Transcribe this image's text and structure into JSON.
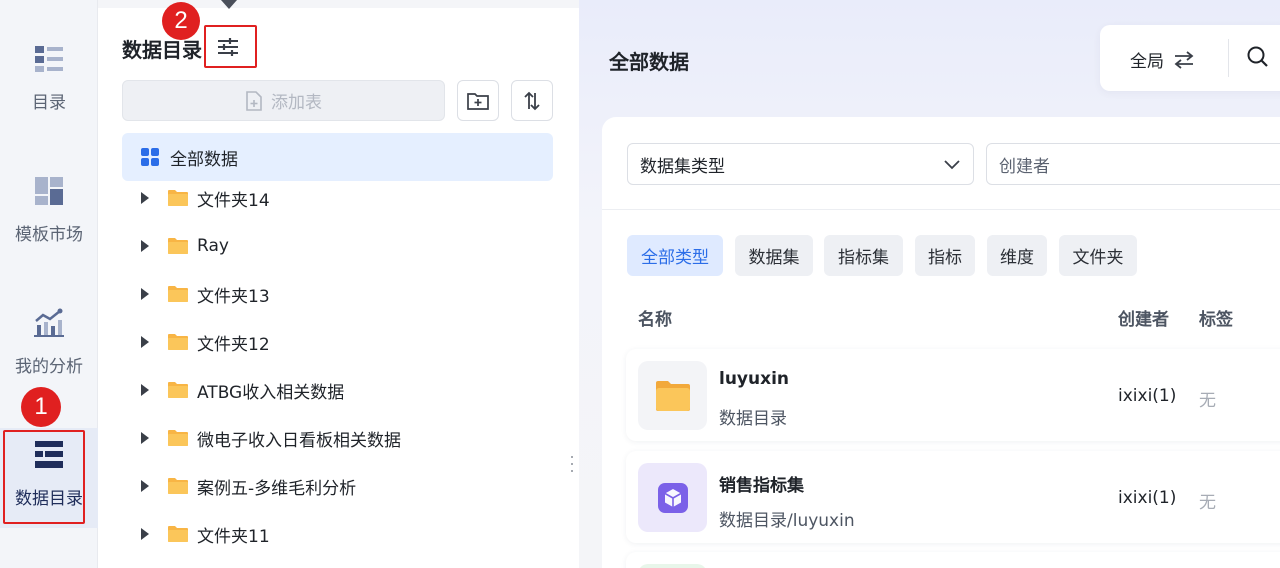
{
  "nav": {
    "items": [
      {
        "label": "目录",
        "icon": "catalog-list-icon"
      },
      {
        "label": "模板市场",
        "icon": "template-grid-icon"
      },
      {
        "label": "我的分析",
        "icon": "analysis-chart-icon"
      },
      {
        "label": "数据目录",
        "icon": "data-catalog-icon",
        "active": true
      }
    ],
    "annotation_1": "1"
  },
  "panel": {
    "title": "数据目录",
    "annotation_2": "2",
    "filter_icon": "filter-sliders-icon",
    "add_table_label": "添加表",
    "add_table_icon": "add-table-icon",
    "new_folder_icon": "folder-plus-icon",
    "sort_icon": "sort-icon",
    "tree_root_label": "全部数据",
    "tree_items": [
      {
        "label": "文件夹14"
      },
      {
        "label": "Ray"
      },
      {
        "label": "文件夹13"
      },
      {
        "label": "文件夹12"
      },
      {
        "label": "ATBG收入相关数据"
      },
      {
        "label": "微电子收入日看板相关数据"
      },
      {
        "label": "案例五-多维毛利分析"
      },
      {
        "label": "文件夹11"
      }
    ]
  },
  "main": {
    "title": "全部数据",
    "scope_label": "全局",
    "scope_icon": "swap-icon",
    "search_icon": "search-icon",
    "filters": {
      "dataset_type_placeholder": "数据集类型",
      "creator_placeholder": "创建者"
    },
    "type_chips": [
      {
        "label": "全部类型",
        "active": true
      },
      {
        "label": "数据集"
      },
      {
        "label": "指标集"
      },
      {
        "label": "指标"
      },
      {
        "label": "维度"
      },
      {
        "label": "文件夹"
      }
    ],
    "columns": {
      "name": "名称",
      "creator": "创建者",
      "tags": "标签"
    },
    "rows": [
      {
        "name": "luyuxin",
        "path": "数据目录",
        "creator": "ixixi(1)",
        "tags": "无",
        "icon": "folder-icon"
      },
      {
        "name": "销售指标集",
        "path": "数据目录/luyuxin",
        "creator": "ixixi(1)",
        "tags": "无",
        "icon": "metric-set-cube-icon"
      }
    ]
  },
  "colors": {
    "accent": "#2b6de8",
    "annotation_red": "#e02020",
    "folder_orange": "#f8b545",
    "metric_purple": "#7b61e8"
  }
}
